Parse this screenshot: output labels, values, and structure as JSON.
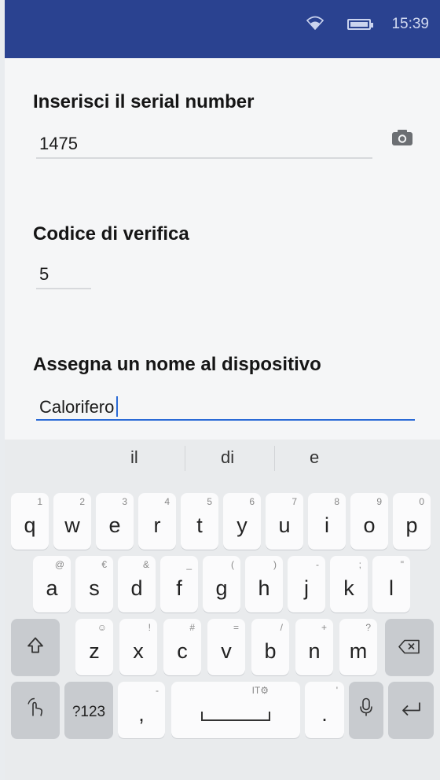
{
  "status_bar": {
    "time": "15:39"
  },
  "form": {
    "serial": {
      "label": "Inserisci il serial number",
      "value": "1475"
    },
    "verify": {
      "label": "Codice di verifica",
      "value": "5"
    },
    "name": {
      "label": "Assegna un nome al dispositivo",
      "value": "Calorifero"
    }
  },
  "keyboard": {
    "suggestions": [
      "il",
      "di",
      "e"
    ],
    "row1": [
      {
        "ch": "q",
        "sub": "1"
      },
      {
        "ch": "w",
        "sub": "2"
      },
      {
        "ch": "e",
        "sub": "3"
      },
      {
        "ch": "r",
        "sub": "4"
      },
      {
        "ch": "t",
        "sub": "5"
      },
      {
        "ch": "y",
        "sub": "6"
      },
      {
        "ch": "u",
        "sub": "7"
      },
      {
        "ch": "i",
        "sub": "8"
      },
      {
        "ch": "o",
        "sub": "9"
      },
      {
        "ch": "p",
        "sub": "0"
      }
    ],
    "row2": [
      {
        "ch": "a",
        "sub": "@"
      },
      {
        "ch": "s",
        "sub": "€"
      },
      {
        "ch": "d",
        "sub": "&"
      },
      {
        "ch": "f",
        "sub": "_"
      },
      {
        "ch": "g",
        "sub": "("
      },
      {
        "ch": "h",
        "sub": ")"
      },
      {
        "ch": "j",
        "sub": "-"
      },
      {
        "ch": "k",
        "sub": ";"
      },
      {
        "ch": "l",
        "sub": "\""
      }
    ],
    "row3": [
      {
        "ch": "z",
        "sub": "☺"
      },
      {
        "ch": "x",
        "sub": "!"
      },
      {
        "ch": "c",
        "sub": "#"
      },
      {
        "ch": "v",
        "sub": "="
      },
      {
        "ch": "b",
        "sub": "/"
      },
      {
        "ch": "n",
        "sub": "+"
      },
      {
        "ch": "m",
        "sub": "?"
      }
    ],
    "symbols_label": "?123",
    "comma": ",",
    "comma_sub": "-",
    "period": ".",
    "period_sub": "'",
    "space_sub": "IT⚙"
  },
  "icons": {
    "wifi": "wifi-icon",
    "battery": "battery-icon",
    "camera": "camera-icon",
    "shift": "shift-icon",
    "backspace": "backspace-icon",
    "gesture": "gesture-icon",
    "mic": "microphone-icon",
    "enter": "enter-icon"
  },
  "colors": {
    "status_bar": "#2a4290",
    "accent": "#2a6ad6"
  }
}
